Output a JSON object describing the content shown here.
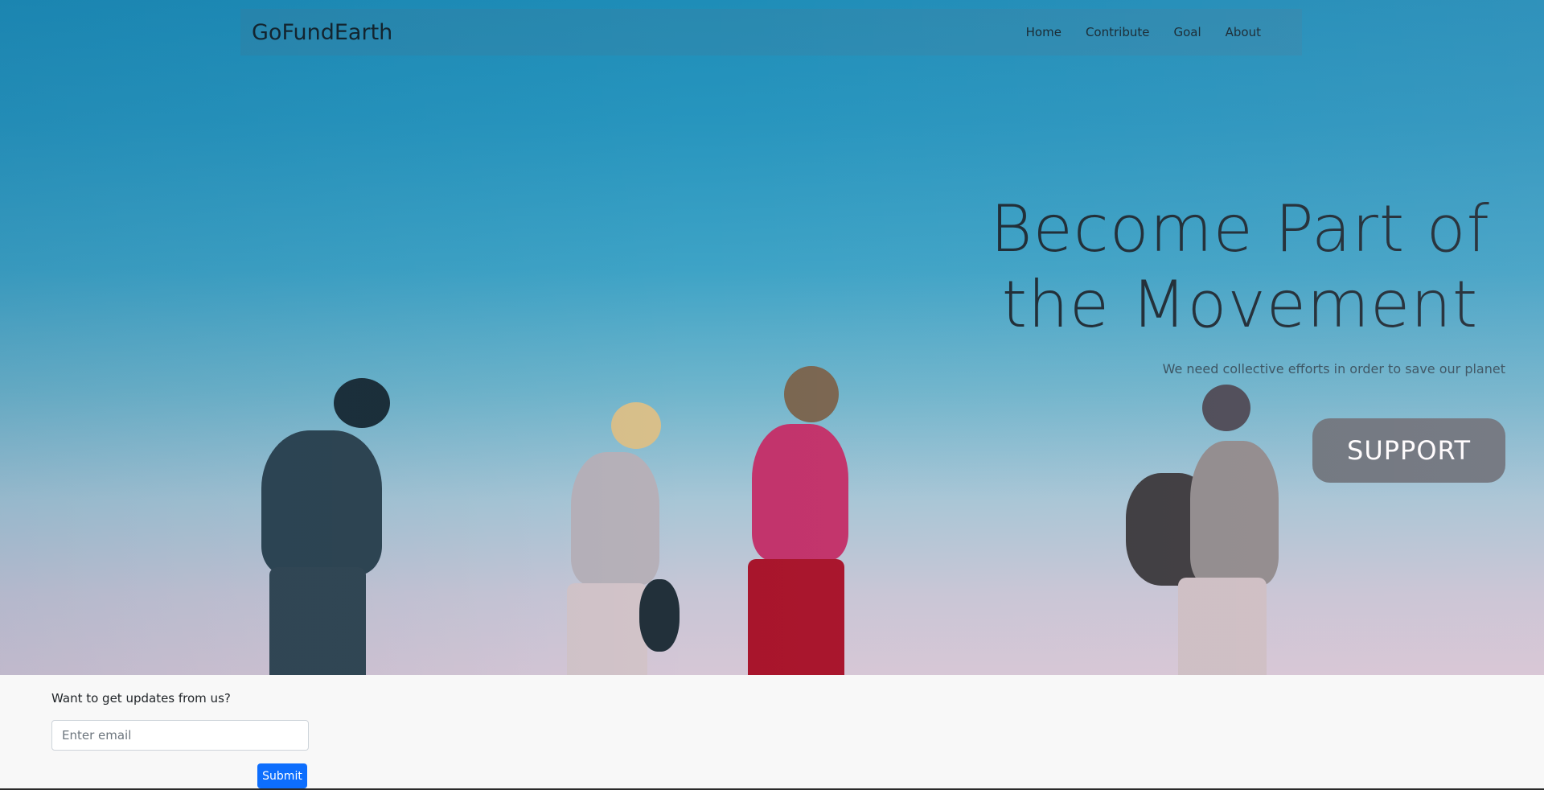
{
  "navbar": {
    "brand": "GoFundEarth",
    "links": [
      {
        "label": "Home"
      },
      {
        "label": "Contribute"
      },
      {
        "label": "Goal"
      },
      {
        "label": "About"
      }
    ]
  },
  "hero": {
    "title_line1": "Become Part of",
    "title_line2": "the Movement",
    "subtitle": "We need collective efforts in order to save our planet",
    "support_label": "SUPPORT"
  },
  "newsletter": {
    "label": "Want to get updates from us?",
    "email_placeholder": "Enter email",
    "submit_label": "Submit"
  },
  "colors": {
    "sky": "#2795be",
    "button_gray": "#6c757d",
    "submit_blue": "#0d6efd",
    "footer_bg": "#f8f8f8"
  }
}
